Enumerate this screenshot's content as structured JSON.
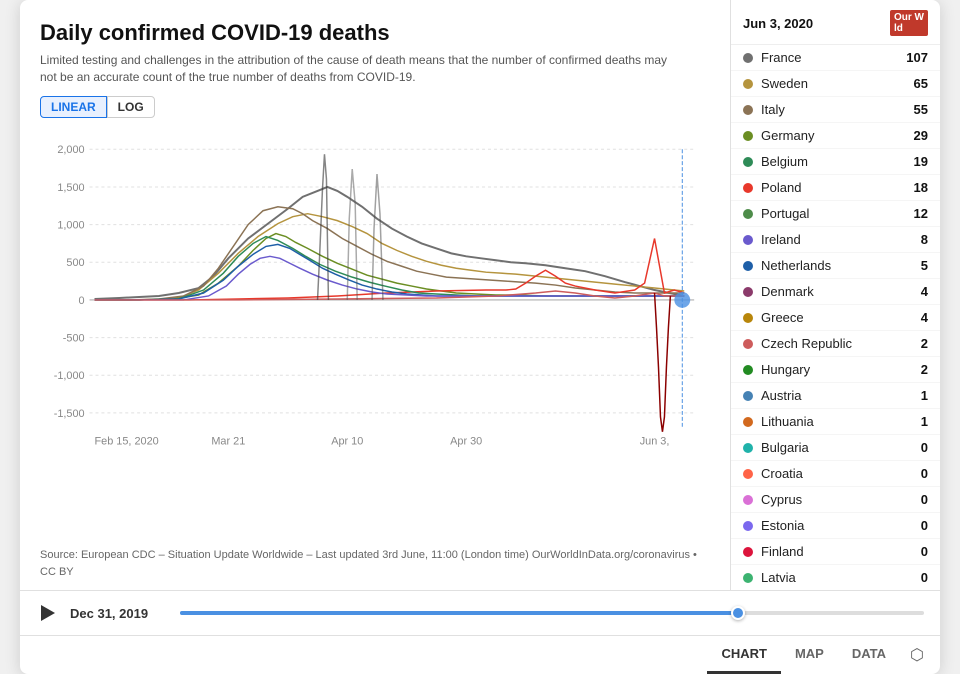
{
  "header": {
    "title": "Daily confirmed COVID-19 deaths",
    "subtitle": "Limited testing and challenges in the attribution of the cause of death means that the number of confirmed deaths may not be an accurate count of the true number of deaths from COVID-19.",
    "scale_linear": "LINEAR",
    "scale_log": "LOG"
  },
  "source": {
    "text": "Source: European CDC – Situation Update Worldwide – Last updated 3rd June, 11:00 (London time)\nOurWorldInData.org/coronavirus • CC BY"
  },
  "sidebar": {
    "date": "Jun 3, 2020",
    "logo": "Our World in Data",
    "countries": [
      {
        "name": "France",
        "value": 107,
        "color": "#707070"
      },
      {
        "name": "Sweden",
        "value": 65,
        "color": "#b5943e"
      },
      {
        "name": "Italy",
        "value": 55,
        "color": "#8b7355"
      },
      {
        "name": "Germany",
        "value": 29,
        "color": "#6b8e23"
      },
      {
        "name": "Belgium",
        "value": 19,
        "color": "#2e8b57"
      },
      {
        "name": "Poland",
        "value": 18,
        "color": "#e8382b"
      },
      {
        "name": "Portugal",
        "value": 12,
        "color": "#4e8c4a"
      },
      {
        "name": "Ireland",
        "value": 8,
        "color": "#6a5acd"
      },
      {
        "name": "Netherlands",
        "value": 5,
        "color": "#1e5fa8"
      },
      {
        "name": "Denmark",
        "value": 4,
        "color": "#8b3a6b"
      },
      {
        "name": "Greece",
        "value": 4,
        "color": "#b8860b"
      },
      {
        "name": "Czech Republic",
        "value": 2,
        "color": "#cd5c5c"
      },
      {
        "name": "Hungary",
        "value": 2,
        "color": "#228b22"
      },
      {
        "name": "Austria",
        "value": 1,
        "color": "#4682b4"
      },
      {
        "name": "Lithuania",
        "value": 1,
        "color": "#d2691e"
      },
      {
        "name": "Bulgaria",
        "value": 0,
        "color": "#20b2aa"
      },
      {
        "name": "Croatia",
        "value": 0,
        "color": "#ff6347"
      },
      {
        "name": "Cyprus",
        "value": 0,
        "color": "#da70d6"
      },
      {
        "name": "Estonia",
        "value": 0,
        "color": "#7b68ee"
      },
      {
        "name": "Finland",
        "value": 0,
        "color": "#dc143c"
      },
      {
        "name": "Latvia",
        "value": 0,
        "color": "#3cb371"
      }
    ]
  },
  "bottom": {
    "date_label": "Dec 31, 2019",
    "play_label": "Play"
  },
  "tabs": [
    {
      "label": "CHART",
      "active": true
    },
    {
      "label": "MAP",
      "active": false
    },
    {
      "label": "DATA",
      "active": false
    }
  ],
  "yAxis": {
    "labels": [
      "2,000",
      "1,500",
      "1,000",
      "500",
      "0",
      "-500",
      "-1,000",
      "-1,500"
    ]
  },
  "xAxis": {
    "labels": [
      "Feb 15, 2020",
      "Mar 21",
      "Apr 10",
      "Apr 30",
      "Jun 3,"
    ]
  }
}
